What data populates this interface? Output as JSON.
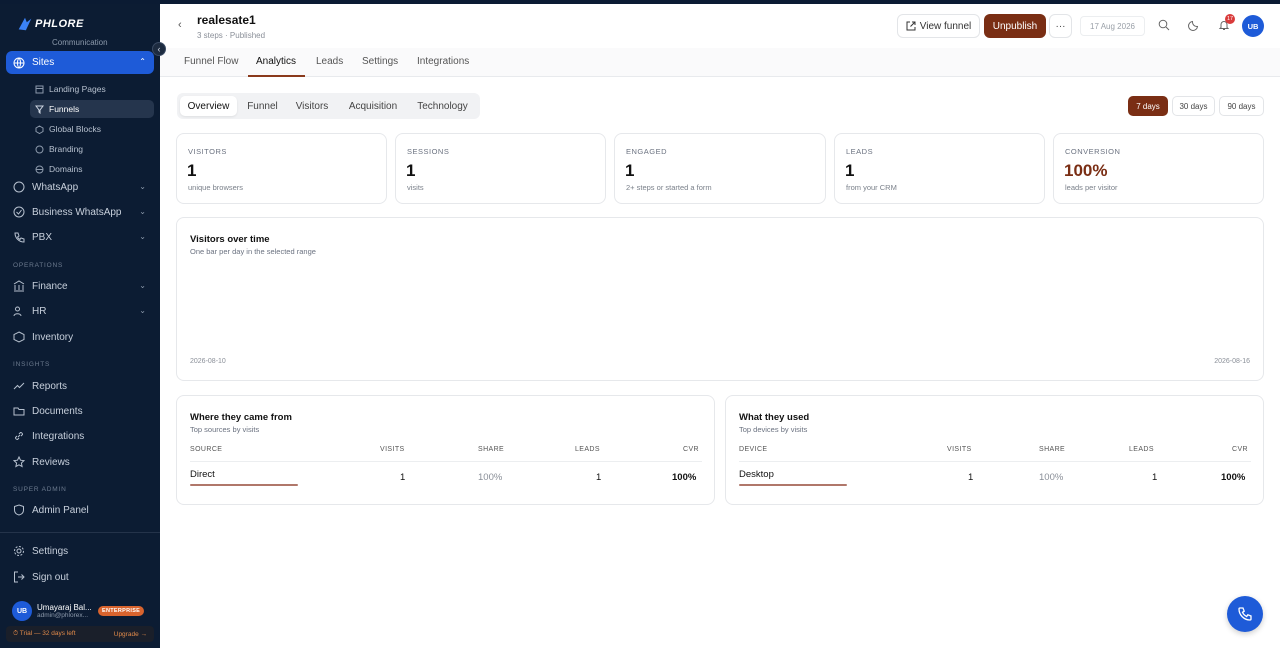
{
  "brand": {
    "logo_text": "PHLORE"
  },
  "sidebar": {
    "cutoff_text": "Communication",
    "active": {
      "label": "Sites"
    },
    "sub_items": [
      {
        "label": "Landing Pages",
        "icon": "layout-icon"
      },
      {
        "label": "Funnels",
        "icon": "funnel-icon"
      },
      {
        "label": "Global Blocks",
        "icon": "cube-icon"
      },
      {
        "label": "Branding",
        "icon": "brush-icon"
      },
      {
        "label": "Domains",
        "icon": "globe-icon"
      }
    ],
    "items": [
      {
        "label": "WhatsApp"
      },
      {
        "label": "Business WhatsApp"
      },
      {
        "label": "PBX"
      },
      {
        "label": "Finance"
      },
      {
        "label": "HR"
      },
      {
        "label": "Inventory"
      },
      {
        "label": "Reports"
      },
      {
        "label": "Documents"
      },
      {
        "label": "Integrations"
      },
      {
        "label": "Reviews"
      },
      {
        "label": "Admin Panel"
      },
      {
        "label": "Settings"
      },
      {
        "label": "Sign out"
      }
    ],
    "sections": {
      "operations": "OPERATIONS",
      "insights": "INSIGHTS",
      "super_admin": "SUPER ADMIN"
    },
    "user": {
      "initials": "UB",
      "name": "Umayaraj Bal...",
      "email": "admin@phlorex...",
      "plan": "ENTERPRISE"
    },
    "trial": {
      "text": "⏱ Trial — 32 days left",
      "upgrade": "Upgrade →"
    }
  },
  "header": {
    "title": "realesate1",
    "subtitle": "3 steps · Published",
    "view_funnel": "View funnel",
    "unpublish": "Unpublish",
    "more": "···",
    "date": "17 Aug 2026",
    "notif_count": "17",
    "avatar": "UB"
  },
  "tabs": [
    "Funnel Flow",
    "Analytics",
    "Leads",
    "Settings",
    "Integrations"
  ],
  "subtabs": [
    "Overview",
    "Funnel",
    "Visitors",
    "Acquisition",
    "Technology"
  ],
  "ranges": [
    "7 days",
    "30 days",
    "90 days"
  ],
  "stats": [
    {
      "label": "VISITORS",
      "value": "1",
      "sub": "unique browsers"
    },
    {
      "label": "SESSIONS",
      "value": "1",
      "sub": "visits"
    },
    {
      "label": "ENGAGED",
      "value": "1",
      "sub": "2+ steps or started a form"
    },
    {
      "label": "LEADS",
      "value": "1",
      "sub": "from your CRM"
    },
    {
      "label": "CONVERSION",
      "value": "100%",
      "sub": "leads per visitor"
    }
  ],
  "visitors_chart": {
    "title": "Visitors over time",
    "subtitle": "One bar per day in the selected range",
    "start": "2026-08-10",
    "end": "2026-08-16"
  },
  "sources": {
    "title": "Where they came from",
    "subtitle": "Top sources by visits",
    "headers": [
      "SOURCE",
      "VISITS",
      "SHARE",
      "LEADS",
      "CVR"
    ],
    "row": {
      "name": "Direct",
      "visits": "1",
      "share": "100%",
      "leads": "1",
      "cvr": "100%"
    }
  },
  "devices": {
    "title": "What they used",
    "subtitle": "Top devices by visits",
    "headers": [
      "DEVICE",
      "VISITS",
      "SHARE",
      "LEADS",
      "CVR"
    ],
    "row": {
      "name": "Desktop",
      "visits": "1",
      "share": "100%",
      "leads": "1",
      "cvr": "100%"
    }
  },
  "colors": {
    "sidebar": "#0c1c33",
    "accent": "#1e5bd8",
    "brand_brown": "#7a2e14"
  }
}
